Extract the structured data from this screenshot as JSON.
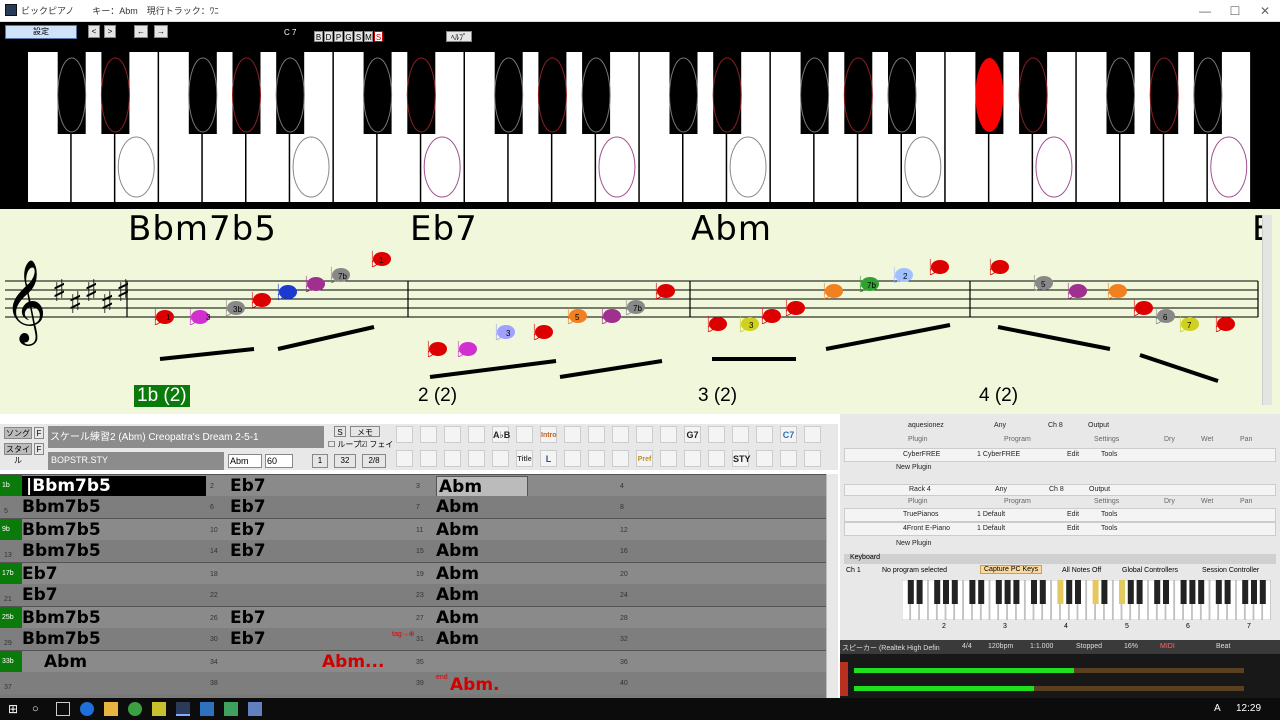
{
  "window": {
    "title": "ビックピアノ　　キー：Abm　現行トラック：ﾜﾆ",
    "minimize": "—",
    "maximize": "☐",
    "close": "✕"
  },
  "piano_toolbar": {
    "settings": "設定",
    "nav_prev": "<",
    "nav_next": ">",
    "nav_back": "←",
    "nav_fwd": "→",
    "octave": "C 7",
    "track_buttons": [
      "B",
      "D",
      "P",
      "G",
      "S",
      "M",
      "S"
    ],
    "help": "ﾍﾙﾌﾟ"
  },
  "notation": {
    "chords": [
      "Bbm7b5",
      "Eb7",
      "Abm",
      "E"
    ],
    "bars": [
      "1b (2)",
      "2 (2)",
      "3 (2)",
      "4 (2)"
    ],
    "note_labels": [
      "1",
      "3",
      "3b",
      "7b",
      "1",
      "3",
      "7b",
      "5",
      "3",
      "7b",
      "2",
      "5",
      "6",
      "7",
      "7b",
      "5",
      "3b",
      "2"
    ]
  },
  "song_panel": {
    "song_label": "ソング",
    "f1": "F",
    "song_title": "スケール練習2 (Abm) Creopatra's Dream 2-5-1",
    "s_btn": "S",
    "memo": "メモ",
    "loop": "ループ",
    "fade": "フェイ",
    "style_label": "スタイル",
    "f2": "F",
    "style_name": "BOPSTR.STY",
    "key": "Abm",
    "tempo": "60",
    "v1": "1",
    "v32": "32",
    "time_sig": "2/8",
    "toolbar_icons_row1": [
      "A♭B",
      "Intro",
      "G7",
      "C7"
    ],
    "toolbar_icons_row2": [
      "Title",
      "L",
      "Pref",
      "STY"
    ]
  },
  "grid": {
    "rows": [
      {
        "part": "1b",
        "cells": [
          {
            "n": "1",
            "c": "Bbm7b5"
          },
          {
            "n": "2",
            "c": "Eb7"
          },
          {
            "n": "3",
            "c": "Abm"
          },
          {
            "n": "4",
            "c": ""
          }
        ]
      },
      {
        "part": "",
        "cells": [
          {
            "n": "5",
            "c": "Bbm7b5"
          },
          {
            "n": "6",
            "c": "Eb7"
          },
          {
            "n": "7",
            "c": "Abm"
          },
          {
            "n": "8",
            "c": ""
          }
        ]
      },
      {
        "part": "9b",
        "cells": [
          {
            "n": "9b",
            "c": "Bbm7b5"
          },
          {
            "n": "10",
            "c": "Eb7"
          },
          {
            "n": "11",
            "c": "Abm"
          },
          {
            "n": "12",
            "c": ""
          }
        ]
      },
      {
        "part": "",
        "cells": [
          {
            "n": "13",
            "c": "Bbm7b5"
          },
          {
            "n": "14",
            "c": "Eb7"
          },
          {
            "n": "15",
            "c": "Abm"
          },
          {
            "n": "16",
            "c": ""
          }
        ]
      },
      {
        "part": "17b",
        "cells": [
          {
            "n": "17b",
            "c": "Eb7"
          },
          {
            "n": "18",
            "c": ""
          },
          {
            "n": "19",
            "c": "Abm"
          },
          {
            "n": "20",
            "c": ""
          }
        ]
      },
      {
        "part": "",
        "cells": [
          {
            "n": "21",
            "c": "Eb7"
          },
          {
            "n": "22",
            "c": ""
          },
          {
            "n": "23",
            "c": "Abm"
          },
          {
            "n": "24",
            "c": ""
          }
        ]
      },
      {
        "part": "25b",
        "cells": [
          {
            "n": "25b",
            "c": "Bbm7b5"
          },
          {
            "n": "26",
            "c": "Eb7"
          },
          {
            "n": "27",
            "c": "Abm"
          },
          {
            "n": "28",
            "c": ""
          }
        ]
      },
      {
        "part": "",
        "cells": [
          {
            "n": "29",
            "c": "Bbm7b5"
          },
          {
            "n": "30",
            "c": "Eb7"
          },
          {
            "n": "31",
            "c": "Abm"
          },
          {
            "n": "32",
            "c": ""
          }
        ]
      },
      {
        "part": "33b",
        "cells": [
          {
            "n": "33b",
            "c": "Abm"
          },
          {
            "n": "34",
            "c": "Abm..."
          },
          {
            "n": "35",
            "c": ""
          },
          {
            "n": "36",
            "c": ""
          }
        ]
      },
      {
        "part": "",
        "cells": [
          {
            "n": "37",
            "c": ""
          },
          {
            "n": "38",
            "c": ""
          },
          {
            "n": "39",
            "c": "Abm."
          },
          {
            "n": "40",
            "c": ""
          }
        ]
      }
    ],
    "tag": "tag",
    "end": "end"
  },
  "rack": {
    "rack1_name": "aquesionez",
    "any": "Any",
    "ch": "Ch 8",
    "output": "Output",
    "plugin_h": "Plugin",
    "program_h": "Program",
    "settings_h": "Settings",
    "dry_h": "Dry",
    "wet_h": "Wet",
    "pan_h": "Pan",
    "plugin1": "CyberFREE",
    "program1": "1 CyberFREE",
    "edit": "Edit",
    "tools": "Tools",
    "new_plugin": "New Plugin",
    "rack4_name": "Rack 4",
    "plugin2": "TruePianos",
    "program2": "1 Default",
    "plugin3": "4Front E-Piano",
    "program3": "1 Default"
  },
  "keyboard_panel": {
    "title": "Keyboard",
    "channel": "Ch 1",
    "program": "No program selected",
    "capture": "Capture PC Keys",
    "all_notes_off": "All Notes Off",
    "global_controllers": "Global Controllers",
    "session_controller": "Session Controller",
    "octaves": [
      "2",
      "3",
      "4",
      "5",
      "6",
      "7"
    ]
  },
  "status": {
    "speaker": "スピーカー (Realtek High Defin",
    "time_sig": "4/4",
    "bpm": "120bpm",
    "position": "1:1.000",
    "state": "Stopped",
    "cpu": "16%",
    "midi": "MIDI",
    "beat": "Beat"
  },
  "taskbar": {
    "clock": "12:29",
    "ime": "A"
  },
  "colors": {
    "active_key": "#ff0000",
    "notation_bg": "#f0f7da",
    "part_marker": "#0a7a0a",
    "grid_bg": "#7a7a7a"
  }
}
